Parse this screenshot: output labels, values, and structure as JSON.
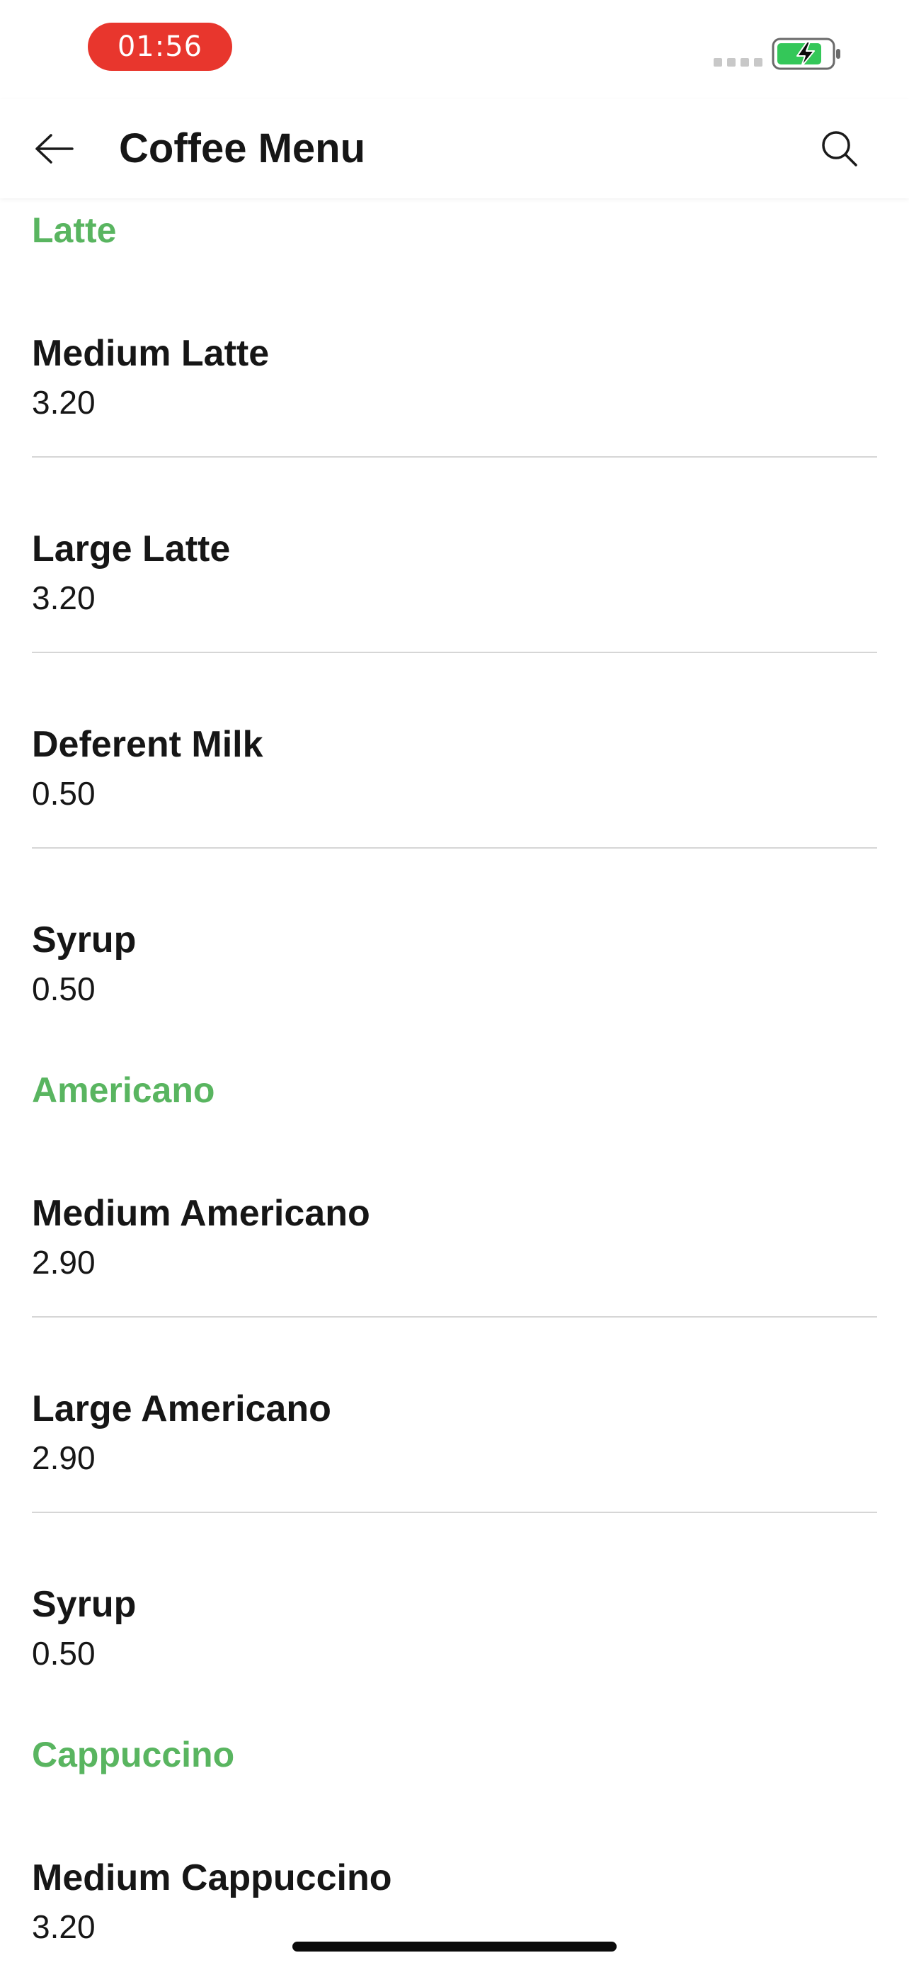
{
  "status_bar": {
    "time": "01:56"
  },
  "app_bar": {
    "title": "Coffee Menu"
  },
  "sections": [
    {
      "title": "Latte",
      "items": [
        {
          "name": "Medium Latte",
          "price": "3.20"
        },
        {
          "name": "Large Latte",
          "price": "3.20"
        },
        {
          "name": "Deferent Milk",
          "price": "0.50"
        },
        {
          "name": "Syrup",
          "price": "0.50"
        }
      ]
    },
    {
      "title": "Americano",
      "items": [
        {
          "name": "Medium Americano",
          "price": "2.90"
        },
        {
          "name": "Large Americano",
          "price": "2.90"
        },
        {
          "name": "Syrup",
          "price": "0.50"
        }
      ]
    },
    {
      "title": "Cappuccino",
      "items": [
        {
          "name": "Medium Cappuccino",
          "price": "3.20"
        }
      ]
    }
  ],
  "colors": {
    "accent": "#59b560",
    "time_pill": "#e8362d",
    "battery": "#34c759"
  },
  "icons": {
    "back": "arrow-left-icon",
    "search": "search-icon"
  }
}
